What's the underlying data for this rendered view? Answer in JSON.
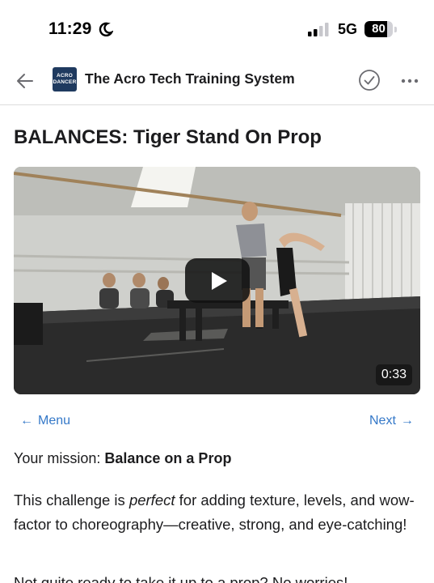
{
  "status_bar": {
    "time": "11:29",
    "network": "5G",
    "battery_level": "80",
    "battery_fraction": 0.8
  },
  "header": {
    "logo_line1": "ACRO",
    "logo_line2": "DANCER",
    "title": "The Acro Tech Training System"
  },
  "lesson": {
    "title": "BALANCES: Tiger Stand On Prop"
  },
  "video": {
    "duration": "0:33"
  },
  "nav": {
    "menu_label": "Menu",
    "next_label": "Next"
  },
  "mission": {
    "prefix": "Your mission: ",
    "value": "Balance on a Prop"
  },
  "intro": {
    "part1": "This challenge is ",
    "emphasis": "perfect",
    "part2": " for adding texture, levels, and wow-factor to choreography—creative, strong, and eye-catching!"
  },
  "next_paragraph": "Not quite ready to take it up to a prop? No worries!",
  "colors": {
    "link": "#3478c8",
    "logo_bg": "#1f3a5f"
  }
}
